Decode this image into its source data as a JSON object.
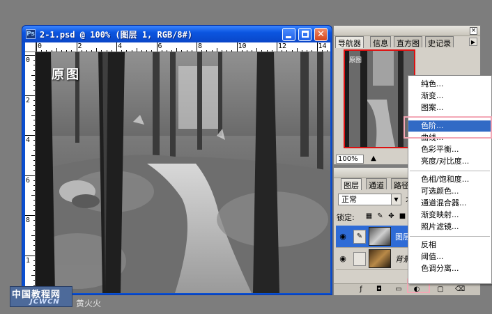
{
  "document_window": {
    "app_icon_label": "Ps",
    "title": "2-1.psd @ 100% (图层 1, RGB/8#)",
    "canvas_label": "原图",
    "ruler_top_numbers": [
      "0",
      "2",
      "4",
      "6",
      "8",
      "10",
      "12",
      "14"
    ],
    "ruler_left_numbers": [
      "0",
      "2",
      "4",
      "6",
      "8",
      "1"
    ],
    "close_glyph": "✕"
  },
  "navigator_panel": {
    "tabs": [
      "导航器",
      "信息",
      "直方图",
      "史记录"
    ],
    "zoom_value": "100%",
    "preview_label": "原图"
  },
  "layers_panel": {
    "tabs": [
      "图层",
      "通道",
      "路径"
    ],
    "blend_mode": "正常",
    "opacity_label": "不",
    "lock_label": "锁定:",
    "layers": [
      {
        "name": "图层",
        "selected": true
      },
      {
        "name": "背景",
        "selected": false
      }
    ]
  },
  "adjustment_menu": {
    "groups": [
      [
        "纯色...",
        "渐变...",
        "图案..."
      ],
      [
        "色阶...",
        "曲线...",
        "色彩平衡...",
        "亮度/对比度..."
      ],
      [
        "色相/饱和度...",
        "可选颜色...",
        "通道混合器...",
        "渐变映射...",
        "照片滤镜..."
      ],
      [
        "反相",
        "阈值...",
        "色调分离..."
      ]
    ],
    "active_item": "色阶..."
  },
  "watermark": {
    "text_cn": "中国教程网",
    "text_en": "JCWCN",
    "author": "黄火火"
  },
  "colors": {
    "desktop": "#7d7d7d",
    "titlebar": "#0b55e0",
    "menu_active": "#316ac5",
    "highlight_box": "#f3a7b5",
    "layer_selected": "#2e6bd6"
  }
}
